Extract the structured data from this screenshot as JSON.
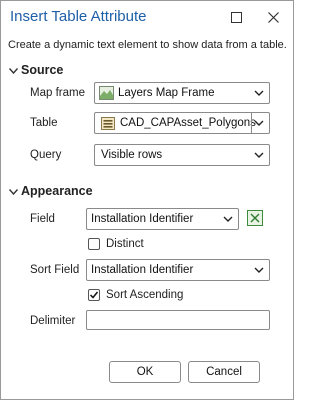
{
  "window": {
    "title": "Insert Table Attribute",
    "description": "Create a dynamic text element to show data from a table."
  },
  "source": {
    "heading": "Source",
    "map_frame_label": "Map frame",
    "map_frame_value": "Layers Map Frame",
    "table_label": "Table",
    "table_value": "CAD_CAPAsset_Polygons",
    "query_label": "Query",
    "query_value": "Visible rows"
  },
  "appearance": {
    "heading": "Appearance",
    "field_label": "Field",
    "field_value": "Installation Identifier",
    "distinct_label": "Distinct",
    "distinct_checked": false,
    "sort_field_label": "Sort Field",
    "sort_field_value": "Installation Identifier",
    "sort_ascending_label": "Sort Ascending",
    "sort_ascending_checked": true,
    "delimiter_label": "Delimiter",
    "delimiter_value": ""
  },
  "buttons": {
    "ok": "OK",
    "cancel": "Cancel"
  }
}
